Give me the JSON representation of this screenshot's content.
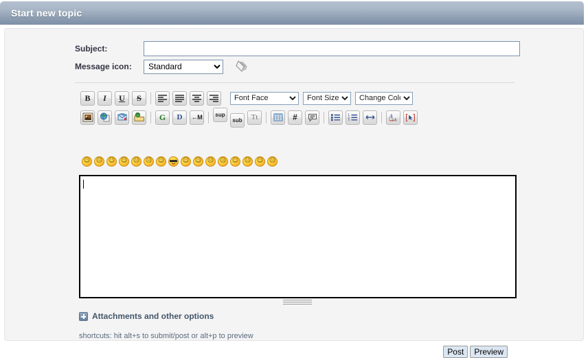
{
  "header": {
    "title": "Start new topic"
  },
  "form": {
    "subject_label": "Subject:",
    "subject_value": "",
    "subject_placeholder": "",
    "message_icon_label": "Message icon:",
    "message_icon_selected": "Standard",
    "message_icon_options": [
      "Standard"
    ]
  },
  "toolbar": {
    "row1": [
      {
        "name": "bold-button",
        "glyph": "B",
        "title": "Bold"
      },
      {
        "name": "italic-button",
        "glyph": "I",
        "title": "Italic"
      },
      {
        "name": "underline-button",
        "glyph": "U",
        "title": "Underline"
      },
      {
        "name": "strikethrough-button",
        "glyph": "S",
        "title": "Strikethrough"
      },
      {
        "name": "align-left-button",
        "glyph": "",
        "title": "Align left"
      },
      {
        "name": "align-justify-button",
        "glyph": "",
        "title": "Justify"
      },
      {
        "name": "align-center-button",
        "glyph": "",
        "title": "Align center"
      },
      {
        "name": "align-right-button",
        "glyph": "",
        "title": "Align right"
      }
    ],
    "font_face_label": "Font Face",
    "font_size_label": "Font Size",
    "change_color_label": "Change Color",
    "font_face_options": [
      "Font Face"
    ],
    "font_size_options": [
      "Font Size"
    ],
    "change_color_options": [
      "Change Color"
    ],
    "row2": [
      {
        "name": "insert-image-button",
        "title": "Insert image"
      },
      {
        "name": "insert-link-button",
        "title": "Insert link"
      },
      {
        "name": "insert-email-button",
        "title": "Insert email"
      },
      {
        "name": "insert-ftp-button",
        "title": "Insert FTP link"
      },
      {
        "name": "glow-button",
        "glyph": "G",
        "title": "Glow"
      },
      {
        "name": "shadow-button",
        "glyph": "D",
        "title": "Shadow"
      },
      {
        "name": "marquee-button",
        "glyph": "M",
        "title": "Marquee"
      },
      {
        "name": "superscript-button",
        "glyph": "sup",
        "title": "Superscript"
      },
      {
        "name": "subscript-button",
        "glyph": "sub",
        "title": "Subscript"
      },
      {
        "name": "teletype-button",
        "glyph": "Tt",
        "title": "Teletype"
      },
      {
        "name": "insert-table-button",
        "title": "Insert table"
      },
      {
        "name": "insert-code-button",
        "glyph": "#",
        "title": "Insert code"
      },
      {
        "name": "insert-quote-button",
        "title": "Insert quote"
      },
      {
        "name": "bulleted-list-button",
        "title": "Bulleted list"
      },
      {
        "name": "numbered-list-button",
        "title": "Numbered list"
      },
      {
        "name": "horizontal-rule-button",
        "title": "Horizontal rule"
      },
      {
        "name": "spellcheck-button",
        "title": "Spell check"
      },
      {
        "name": "toggle-view-button",
        "title": "Toggle view"
      }
    ]
  },
  "smilies": [
    {
      "name": "smiley-smile",
      "glyph": "☺"
    },
    {
      "name": "smiley-wink",
      "glyph": "ʘ"
    },
    {
      "name": "smiley-cheesy",
      "glyph": "D"
    },
    {
      "name": "smiley-grin",
      "glyph": "□"
    },
    {
      "name": "smiley-angry",
      "glyph": "×"
    },
    {
      "name": "smiley-sad",
      "glyph": "⌢"
    },
    {
      "name": "smiley-wink2",
      "glyph": "⊛"
    },
    {
      "name": "smiley-cool",
      "glyph": "▬"
    },
    {
      "name": "smiley-tongue",
      "glyph": "ρ"
    },
    {
      "name": "smiley-rolleyes",
      "glyph": "¨"
    },
    {
      "name": "smiley-undecided",
      "glyph": "⌣"
    },
    {
      "name": "smiley-embarrassed",
      "glyph": "≈"
    },
    {
      "name": "smiley-lipsrsealed",
      "glyph": "≡"
    },
    {
      "name": "smiley-kiss",
      "glyph": "˜"
    },
    {
      "name": "smiley-tongue2",
      "glyph": "ο"
    },
    {
      "name": "smiley-cry",
      "glyph": "∵"
    }
  ],
  "message": {
    "value": "",
    "placeholder": ""
  },
  "attachments": {
    "label": "Attachments and other options"
  },
  "shortcuts": {
    "text": "shortcuts: hit alt+s to submit/post or alt+p to preview"
  },
  "buttons": {
    "post_label": "Post",
    "preview_label": "Preview"
  },
  "colors": {
    "header_gradient_top": "#b4c0ce",
    "header_gradient_bottom": "#7e90a6",
    "panel_background": "#f4f4f4",
    "input_border": "#7a94ad",
    "button_background": "#dbe6f2",
    "label_text": "#334455",
    "link_text": "#44566b"
  }
}
